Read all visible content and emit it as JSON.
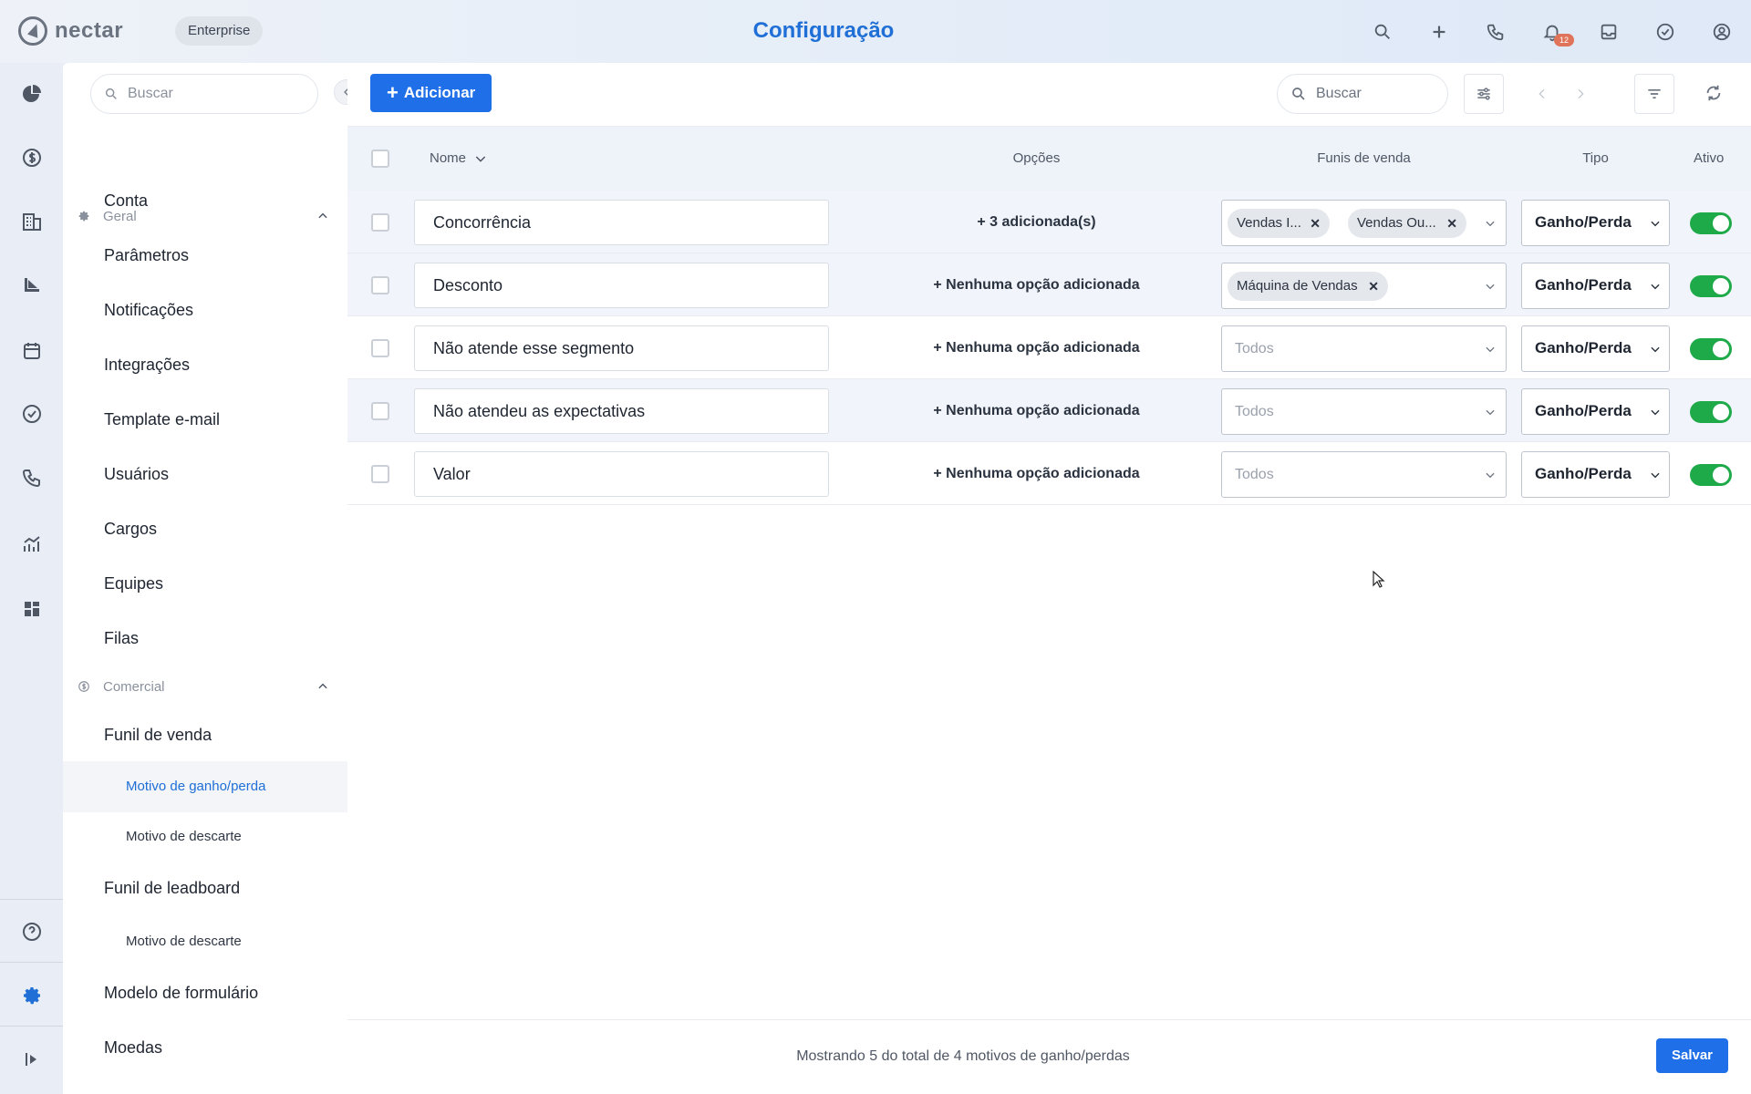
{
  "topbar": {
    "logo_text": "nectar",
    "plan_badge": "Enterprise",
    "title": "Configuração",
    "icons": [
      "search-icon",
      "plus-icon",
      "phone-icon",
      "bell-icon",
      "inbox-icon",
      "check-circle-icon",
      "user-circle-icon"
    ],
    "notification_count": "12"
  },
  "rail": {
    "icons": [
      "pie-chart-icon",
      "dollar-icon",
      "building-icon",
      "funnel-chart-icon",
      "calendar-icon",
      "check-circle-icon",
      "phone-icon",
      "analytics-icon",
      "dashboard-icon",
      "help-icon",
      "gear-icon",
      "expand-icon"
    ],
    "active": "gear-icon"
  },
  "sidebar": {
    "search_placeholder": "Buscar",
    "sections": [
      {
        "title": "Geral",
        "items": [
          "Conta",
          "Parâmetros",
          "Notificações",
          "Integrações",
          "Template e-mail",
          "Usuários",
          "Cargos",
          "Equipes",
          "Filas"
        ]
      },
      {
        "title": "Comercial",
        "items": [
          "Funil de venda",
          "Motivo de ganho/perda",
          "Motivo de descarte",
          "Funil de leadboard",
          "Motivo de descarte",
          "Modelo de formulário",
          "Moedas"
        ]
      }
    ],
    "active_item": "Motivo de ganho/perda"
  },
  "toolbar": {
    "add_label": "Adicionar",
    "search_placeholder": "Buscar"
  },
  "table": {
    "columns": [
      "Nome",
      "Opções",
      "Funis de venda",
      "Tipo",
      "Ativo"
    ],
    "rows": [
      {
        "name": "Concorrência",
        "options": "3 adicionada(s)",
        "funnels": [
          "Vendas I...",
          "Vendas Ou..."
        ],
        "type": "Ganho/Perda",
        "active": true
      },
      {
        "name": "Desconto",
        "options": "Nenhuma opção adicionada",
        "funnels": [
          "Máquina de Vendas"
        ],
        "type": "Ganho/Perda",
        "active": true
      },
      {
        "name": "Não atende esse segmento",
        "options": "Nenhuma opção adicionada",
        "funnels": [],
        "funnels_placeholder": "Todos",
        "type": "Ganho/Perda",
        "active": true
      },
      {
        "name": "Não atendeu as expectativas",
        "options": "Nenhuma opção adicionada",
        "funnels": [],
        "funnels_placeholder": "Todos",
        "type": "Ganho/Perda",
        "active": true
      },
      {
        "name": "Valor",
        "options": "Nenhuma opção adicionada",
        "funnels": [],
        "funnels_placeholder": "Todos",
        "type": "Ganho/Perda",
        "active": true
      }
    ]
  },
  "footer": {
    "summary": "Mostrando 5 do total de 4 motivos de ganho/perdas",
    "save_label": "Salvar"
  },
  "colors": {
    "accent": "#1f6fe8",
    "title": "#1f6fd6",
    "toggle_on": "#1faa4a",
    "badge": "#e0745a"
  }
}
